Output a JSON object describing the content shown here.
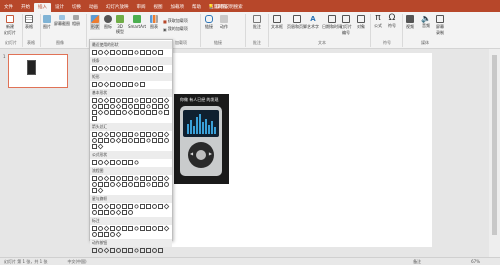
{
  "tabs": [
    "文件",
    "开始",
    "插入",
    "设计",
    "切换",
    "动画",
    "幻灯片放映",
    "审阅",
    "视图",
    "加载项",
    "帮助",
    "百度网盘"
  ],
  "active_tab": "插入",
  "tell_me": "操作说明搜索",
  "ribbon": {
    "new_slide": "新建\n幻灯片",
    "table": "表格",
    "image": "图片",
    "screenshot": "屏幕截图",
    "album": "相册",
    "shapes": "形状",
    "icons": "图标",
    "model3d": "3D\n模型",
    "smartart": "SmartArt",
    "chart": "图表",
    "link": "链接",
    "action": "动作",
    "comment": "批注",
    "textbox": "文本框",
    "header_footer": "页眉和页脚",
    "wordart": "艺术字",
    "date_time": "日期和时间",
    "slide_number": "幻灯片\n编号",
    "object": "对象",
    "equation": "公式",
    "symbol": "符号",
    "video": "视频",
    "audio": "音频",
    "screen_record": "屏幕\n录制",
    "store": "获取加载项",
    "my_addins": "我的加载项",
    "group_slides": "幻灯片",
    "group_tables": "表格",
    "group_images": "图像",
    "group_addins": "加载项",
    "group_links": "链接",
    "group_comments": "批注",
    "group_text": "文本",
    "group_symbols": "符号",
    "group_media": "媒体"
  },
  "dropdown": {
    "sections": [
      "最近使用的形状",
      "线条",
      "矩形",
      "基本形状",
      "箭头总汇",
      "公式形状",
      "流程图",
      "星与旗帜",
      "标注",
      "动作按钮"
    ]
  },
  "thumb": {
    "number": "1"
  },
  "slide_title": "你做 有人已经 的发现",
  "status": {
    "slide_info": "幻灯片 第 1 张，共 1 张",
    "lang": "中文(中国)",
    "notes": "备注",
    "zoom": "67%"
  },
  "colors": {
    "accent": "#b7472a",
    "bars": "#3aa0d8"
  }
}
